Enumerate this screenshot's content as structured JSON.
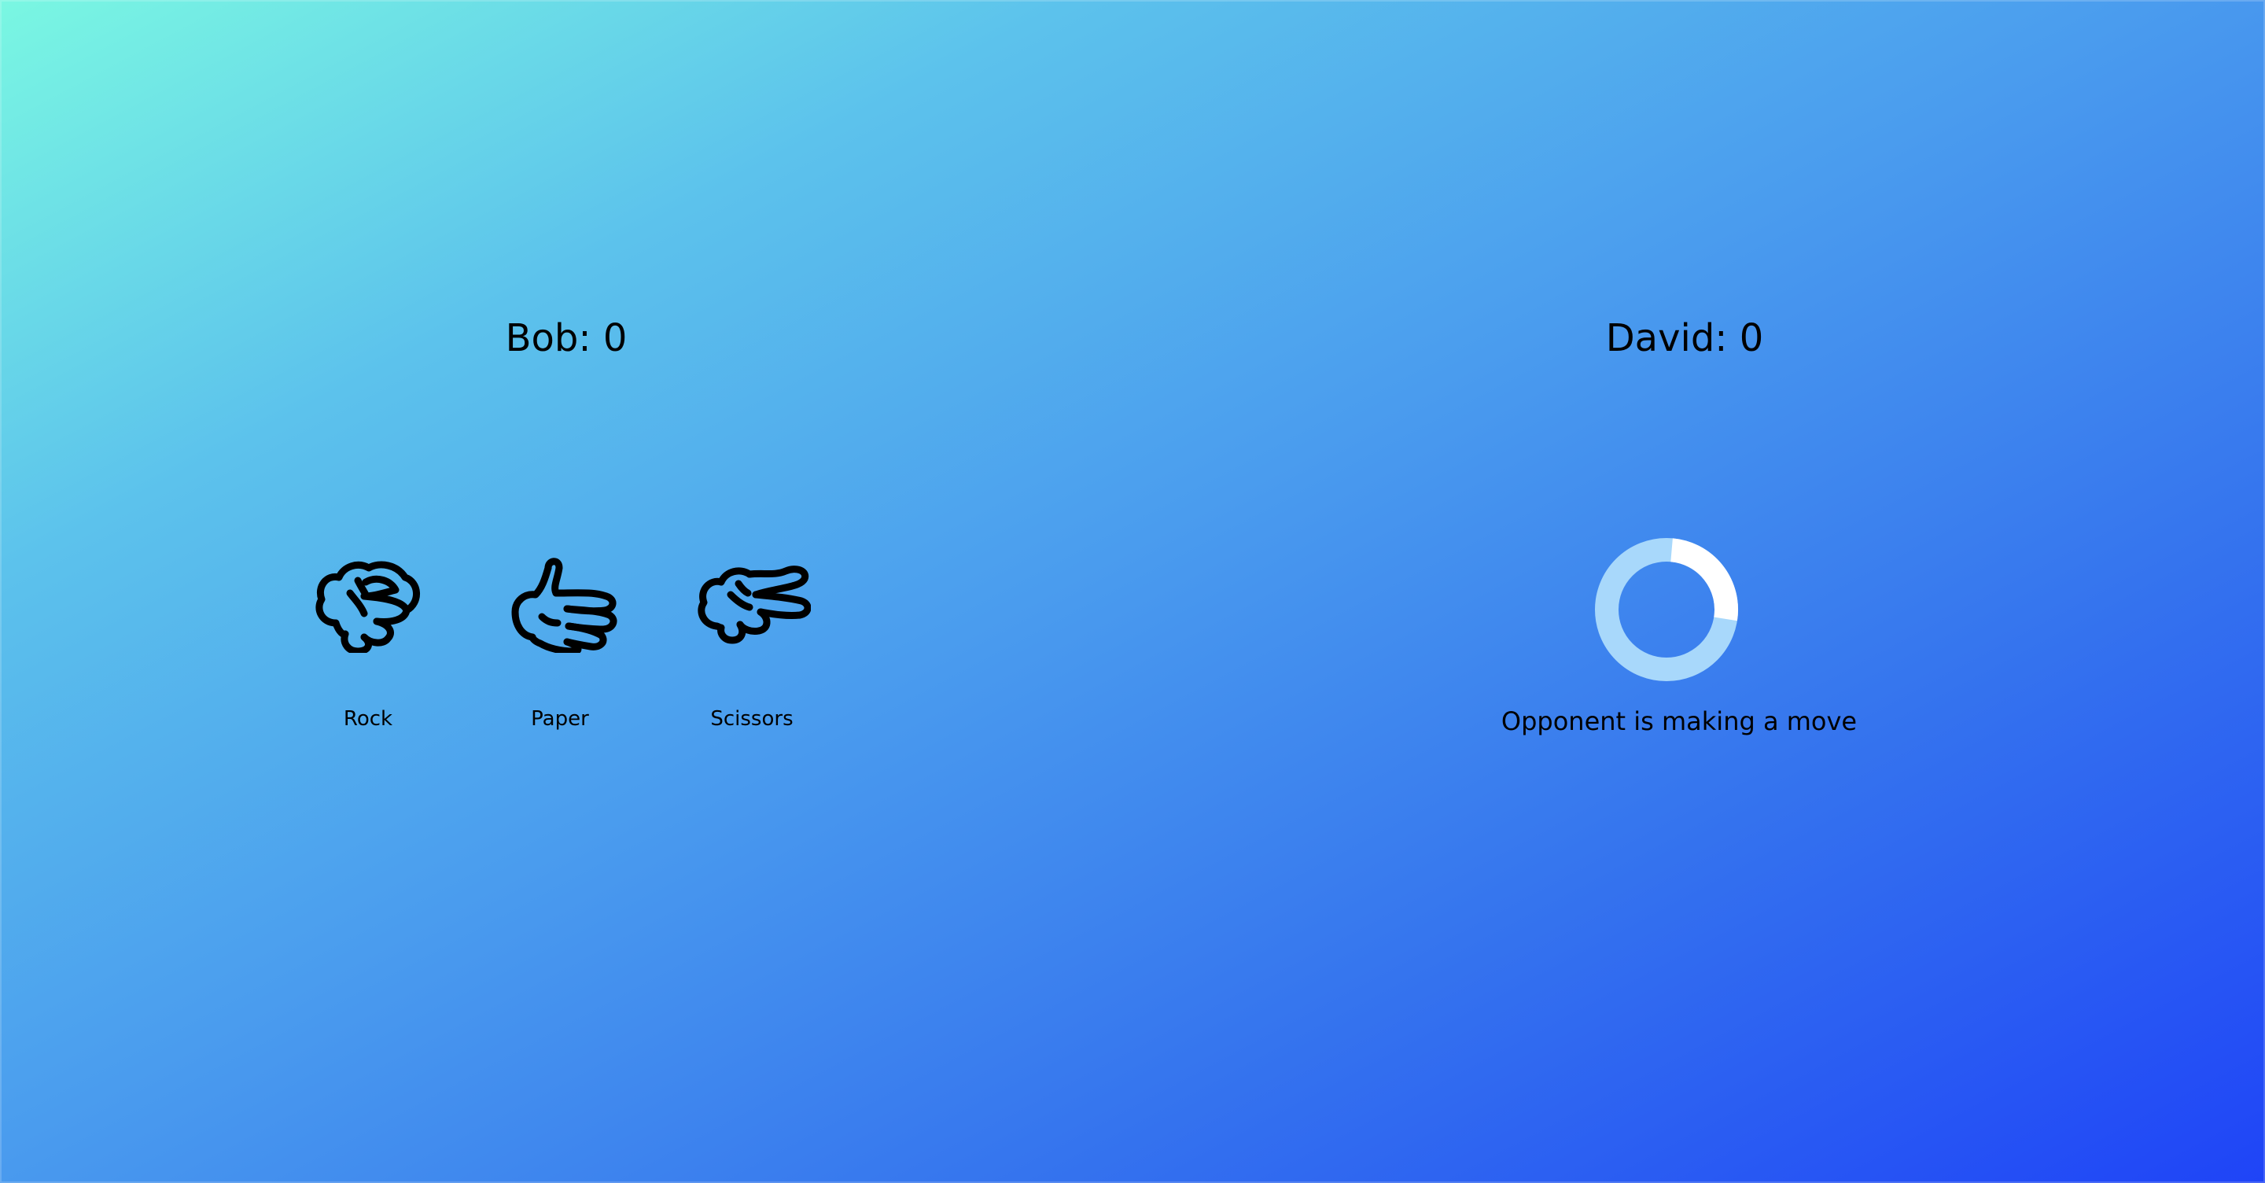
{
  "player": {
    "name": "Bob",
    "score": 0,
    "score_text": "Bob: 0"
  },
  "opponent": {
    "name": "David",
    "score": 0,
    "score_text": "David: 0",
    "status": "Opponent is making a move"
  },
  "moves": [
    {
      "id": "rock",
      "label": "Rock",
      "icon": "rock-hand-icon"
    },
    {
      "id": "paper",
      "label": "Paper",
      "icon": "paper-hand-icon"
    },
    {
      "id": "scissors",
      "label": "Scissors",
      "icon": "scissors-hand-icon"
    }
  ],
  "loading": {
    "icon": "loading-spinner-icon",
    "track_color": "#a8d8fb",
    "arc_color": "#ffffff"
  },
  "colors": {
    "gradient_start": "#7af7e2",
    "gradient_end": "#1f44f7",
    "text": "#000000"
  }
}
